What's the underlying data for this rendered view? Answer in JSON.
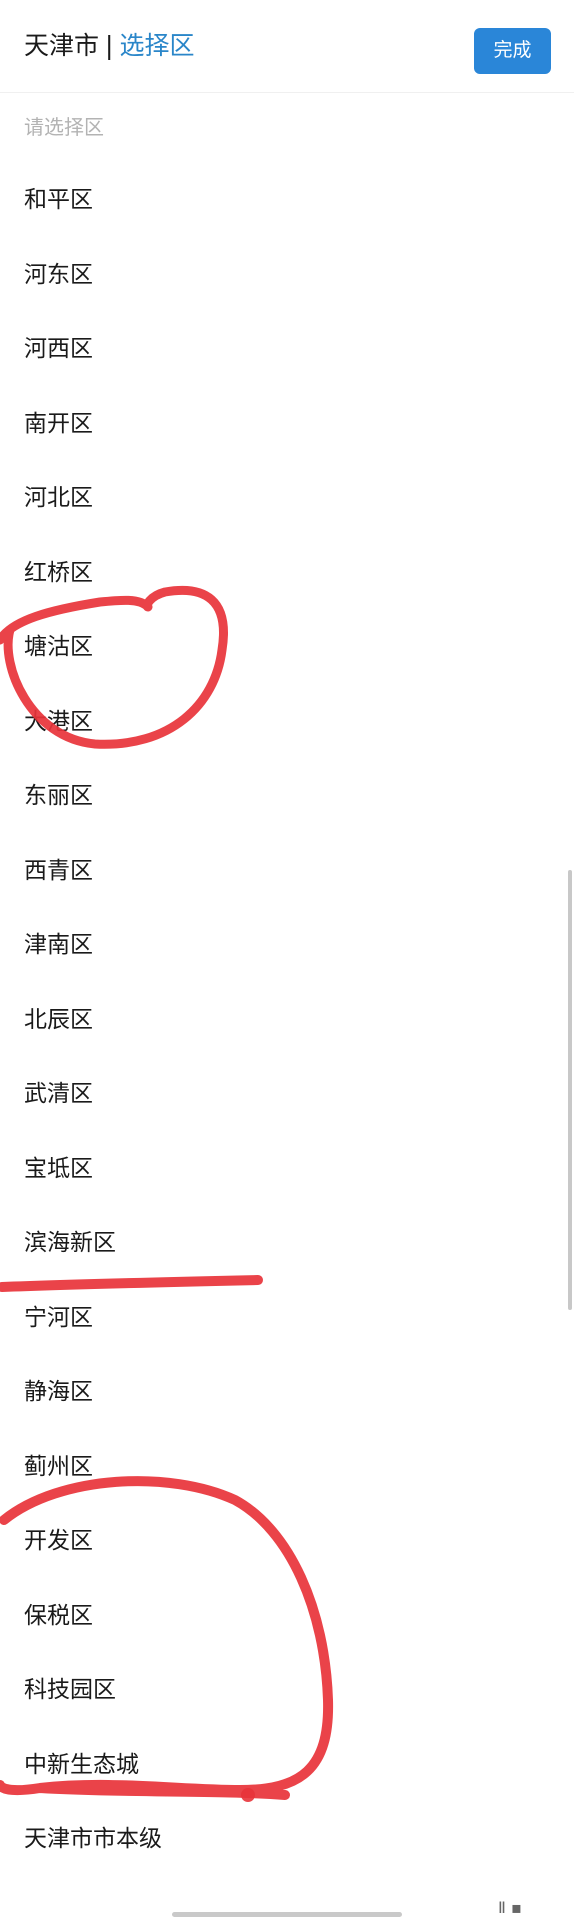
{
  "header": {
    "city": "天津市",
    "separator": "|",
    "crumb": "选择区",
    "done_label": "完成"
  },
  "placeholder": "请选择区",
  "districts": [
    "和平区",
    "河东区",
    "河西区",
    "南开区",
    "河北区",
    "红桥区",
    "塘沽区",
    "大港区",
    "东丽区",
    "西青区",
    "津南区",
    "北辰区",
    "武清区",
    "宝坻区",
    "滨海新区",
    "宁河区",
    "静海区",
    "蓟州区",
    "开发区",
    "保税区",
    "科技园区",
    "中新生态城",
    "天津市市本级"
  ],
  "colors": {
    "accent": "#2a86d8",
    "annotation": "#e8333a",
    "placeholder": "#b3b3b3"
  },
  "watermark": "Ⅱ ▪"
}
